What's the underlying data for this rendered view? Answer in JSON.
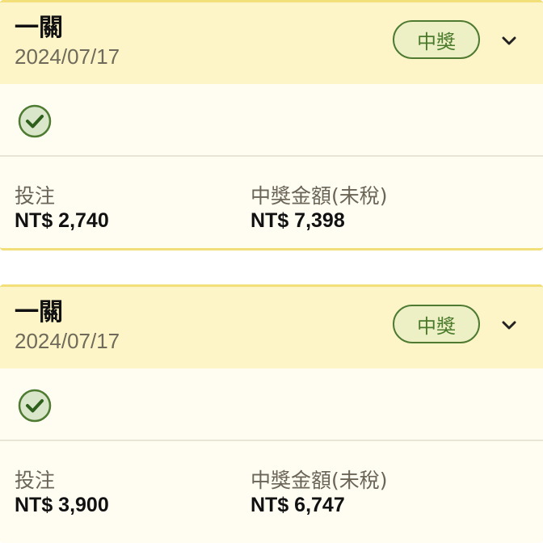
{
  "tickets": [
    {
      "title": "一關",
      "date": "2024/07/17",
      "status_badge": "中獎",
      "stake_label": "投注",
      "stake_value": "NT$ 2,740",
      "payout_label": "中獎金額(未稅)",
      "payout_value": "NT$ 7,398"
    },
    {
      "title": "一關",
      "date": "2024/07/17",
      "status_badge": "中獎",
      "stake_label": "投注",
      "stake_value": "NT$ 3,900",
      "payout_label": "中獎金額(未稅)",
      "payout_value": "NT$ 6,747"
    }
  ],
  "colors": {
    "header_bg": "#fdf5c8",
    "card_bg": "#fffdf2",
    "border": "#f2df7a",
    "win_green": "#4e7a32"
  }
}
